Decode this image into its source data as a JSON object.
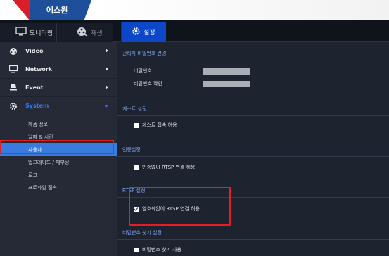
{
  "brand": {
    "name": "에스원"
  },
  "tabs": [
    {
      "label": "모니터링",
      "icon": "monitor-icon"
    },
    {
      "label": "재생",
      "icon": "film-reel-icon"
    },
    {
      "label": "설정",
      "icon": "gear-icon"
    }
  ],
  "sidebar": {
    "menu": [
      {
        "label": "Video",
        "icon": "video-reel-icon"
      },
      {
        "label": "Network",
        "icon": "network-monitor-icon"
      },
      {
        "label": "Event",
        "icon": "event-icon"
      },
      {
        "label": "System",
        "icon": "gear-icon"
      }
    ],
    "submenu": [
      {
        "label": "제품 정보"
      },
      {
        "label": "날짜 & 시간"
      },
      {
        "label": "사용자"
      },
      {
        "label": "업그레이드 / 재부팅"
      },
      {
        "label": "로그"
      },
      {
        "label": "프로파일 접속"
      }
    ],
    "active_submenu": "사용자"
  },
  "main": {
    "admin_password": {
      "title": "관리자 비밀번호 변경",
      "password_label": "비밀번호",
      "confirm_label": "비밀번호 확인",
      "password_value": "",
      "confirm_value": ""
    },
    "guest": {
      "title": "게스트 설정",
      "checkbox_label": "게스트 접속 허용",
      "checked": false
    },
    "auth": {
      "title": "인증설정",
      "checkbox_label": "인증없이 RTSP 연결 허용",
      "checked": false
    },
    "rtsp": {
      "title": "RTSP 설정",
      "checkbox_label": "암호화없이 RTSP 연결 허용",
      "checked": true
    },
    "find_password": {
      "title": "비밀번호 찾기 설정",
      "checkbox_label": "비밀번호 찾기 사용",
      "checked": false
    }
  },
  "colors": {
    "accent": "#0d47c7",
    "active_item": "#3a7be0",
    "highlight": "#e41e24",
    "section_title": "#7fa4e8"
  }
}
